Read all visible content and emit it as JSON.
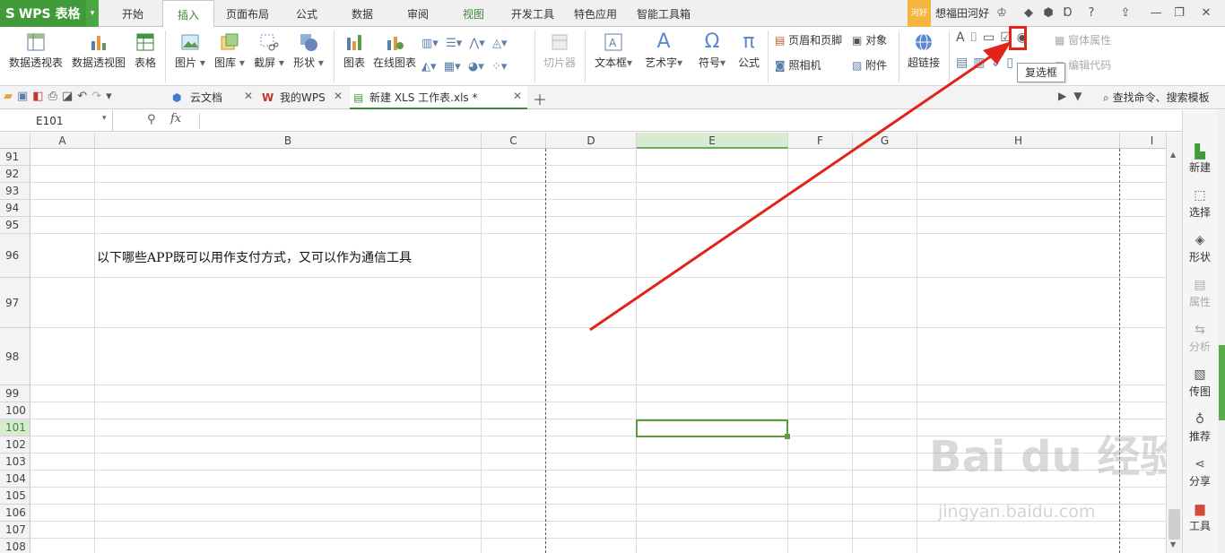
{
  "app": {
    "name": "WPS 表格"
  },
  "menu_tabs": [
    {
      "label": "开始"
    },
    {
      "label": "插入"
    },
    {
      "label": "页面布局"
    },
    {
      "label": "公式"
    },
    {
      "label": "数据"
    },
    {
      "label": "审阅"
    },
    {
      "label": "视图"
    },
    {
      "label": "开发工具"
    },
    {
      "label": "特色应用"
    },
    {
      "label": "智能工具箱"
    }
  ],
  "user": {
    "badge": "河好",
    "name": "想福田河好"
  },
  "ribbon": {
    "pivot_table": "数据透视表",
    "pivot_chart": "数据透视图",
    "table": "表格",
    "picture": "图片",
    "gallery": "图库",
    "screenshot": "截屏",
    "shape": "形状",
    "chart": "图表",
    "online_chart": "在线图表",
    "slicer": "切片器",
    "textbox": "文本框",
    "wordart": "艺术字",
    "symbol": "符号",
    "formula": "公式",
    "header_footer": "页眉和页脚",
    "camera": "照相机",
    "object": "对象",
    "attachment": "附件",
    "hyperlink": "超链接",
    "form_props": "窗体属性",
    "edit_code": "编辑代码"
  },
  "tooltip": "复选框",
  "doc_tabs": [
    {
      "label": "云文档"
    },
    {
      "label": "我的WPS"
    },
    {
      "label": "新建 XLS 工作表.xls *"
    }
  ],
  "search_cmd": "查找命令、搜索模板",
  "formula_bar": {
    "name_box": "E101",
    "fx": "fx"
  },
  "columns": [
    "A",
    "B",
    "C",
    "D",
    "E",
    "F",
    "G",
    "H",
    "I"
  ],
  "rows": [
    "91",
    "92",
    "93",
    "94",
    "95",
    "96",
    "97",
    "98",
    "99",
    "100",
    "101",
    "102",
    "103",
    "104",
    "105",
    "106",
    "107",
    "108"
  ],
  "cell_text": "以下哪些APP既可以用作支付方式，又可以作为通信工具",
  "side_panel": [
    {
      "label": "新建"
    },
    {
      "label": "选择"
    },
    {
      "label": "形状"
    },
    {
      "label": "属性"
    },
    {
      "label": "分析"
    },
    {
      "label": "传图"
    },
    {
      "label": "推荐"
    },
    {
      "label": "分享"
    },
    {
      "label": "工具"
    }
  ],
  "watermark": {
    "main": "Bai du 经验",
    "sub": "jingyan.baidu.com"
  },
  "colors": {
    "accent": "#3f9b3a",
    "annotation": "#e2231a"
  }
}
